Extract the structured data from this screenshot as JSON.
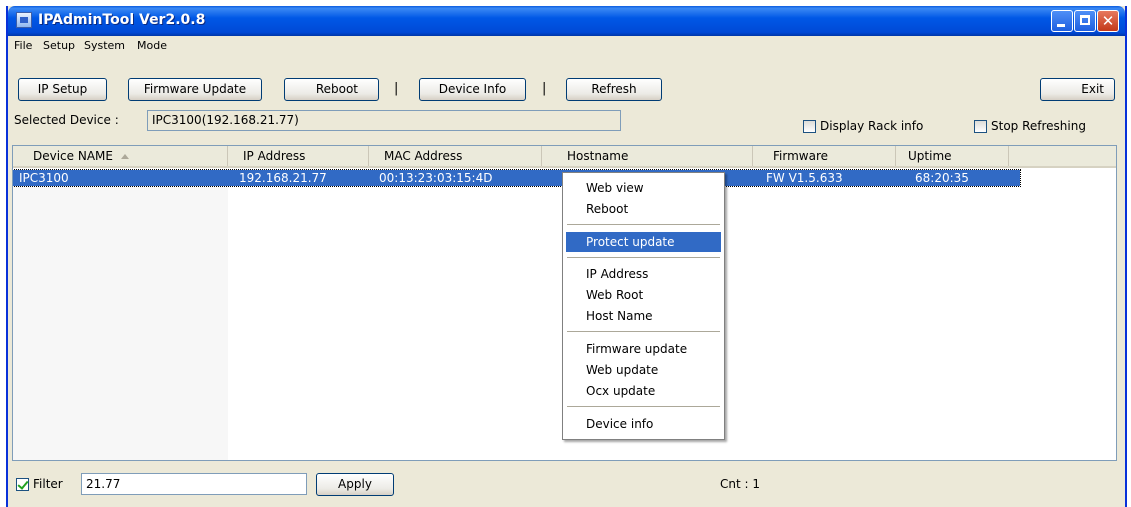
{
  "window": {
    "title": "IPAdminTool Ver2.0.8"
  },
  "menubar": {
    "items": [
      "File",
      "Setup",
      "System",
      "Mode"
    ]
  },
  "toolbar": {
    "ip_setup": "IP Setup",
    "firmware_update": "Firmware Update",
    "reboot": "Reboot",
    "separator": "|",
    "device_info": "Device Info",
    "refresh": "Refresh",
    "exit": "Exit"
  },
  "selected_device": {
    "label": "Selected Device :",
    "value": "IPC3100(192.168.21.77)"
  },
  "options": {
    "display_rack_info": {
      "label": "Display Rack info",
      "checked": false
    },
    "stop_refreshing": {
      "label": "Stop Refreshing",
      "checked": false
    }
  },
  "table": {
    "columns": [
      "Device NAME",
      "IP Address",
      "MAC Address",
      "Hostname",
      "Firmware",
      "Uptime"
    ],
    "sort_column": "Device NAME",
    "rows": [
      {
        "device_name": "IPC3100",
        "ip": "192.168.21.77",
        "mac": "00:13:23:03:15:4D",
        "hostname": "",
        "firmware": "FW V1.5.633",
        "uptime": "68:20:35",
        "selected": true
      }
    ]
  },
  "context_menu": {
    "items": [
      "Web view",
      "Reboot",
      "Protect update",
      "IP Address",
      "Web Root",
      "Host Name",
      "Firmware update",
      "Web update",
      "Ocx update",
      "Device info"
    ],
    "highlighted": "Protect update"
  },
  "footer": {
    "filter_label": "Filter",
    "filter_checked": true,
    "filter_value": "21.77",
    "apply": "Apply",
    "count": "Cnt : 1"
  },
  "colors": {
    "titlebar": "#0058e6",
    "selection": "#316ac5",
    "window_bg": "#ece9d8"
  }
}
